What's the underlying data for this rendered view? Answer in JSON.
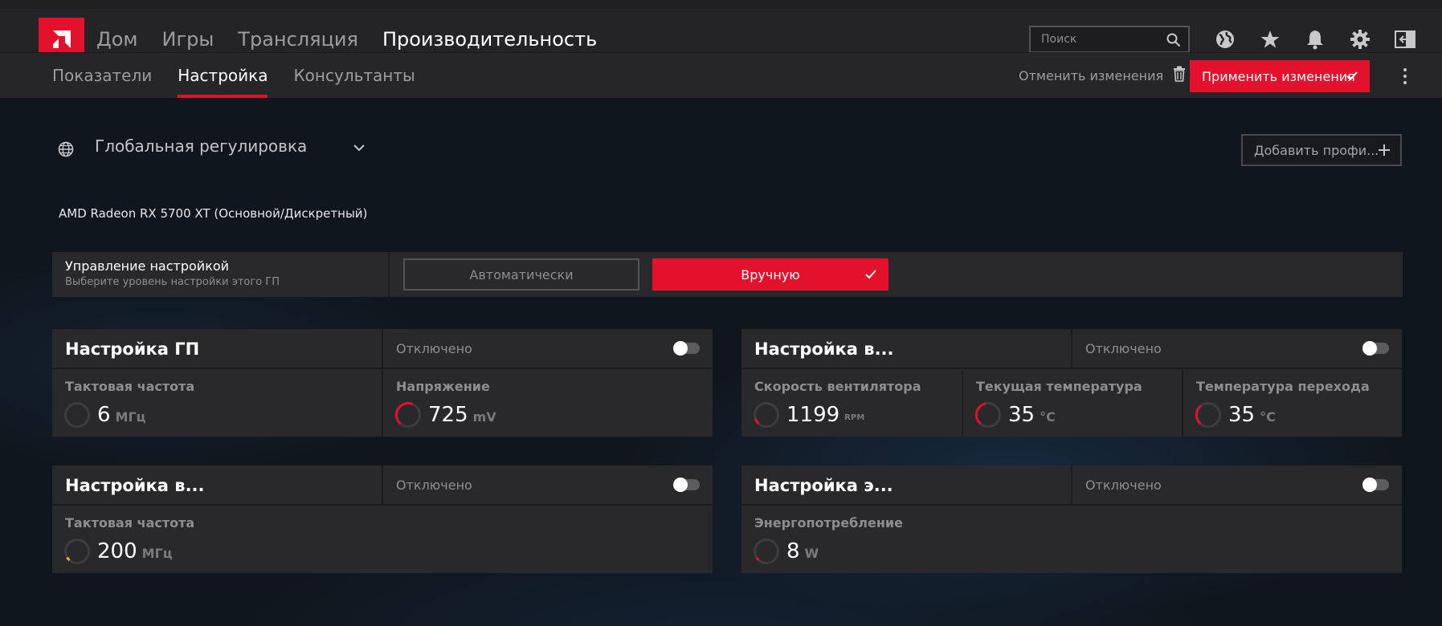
{
  "nav": {
    "main_tabs": [
      "Дом",
      "Игры",
      "Трансляция",
      "Производительность"
    ],
    "active_main": "Производительность",
    "sub_tabs": [
      "Показатели",
      "Настройка",
      "Консультанты"
    ],
    "active_sub": "Настройка"
  },
  "search": {
    "placeholder": "Поиск"
  },
  "header_icons": [
    "globe-icon",
    "star-icon",
    "bell-icon",
    "gear-icon",
    "sidebar-exit-icon"
  ],
  "actions": {
    "discard_label": "Отменить изменения",
    "apply_label": "Применить изменения"
  },
  "profile": {
    "selected": "Глобальная регулировка",
    "add_label": "Добавить профи..."
  },
  "gpu": {
    "name": "AMD Radeon RX 5700 XT (Основной/Дискретный)"
  },
  "tuning_control": {
    "title": "Управление настройкой",
    "subtitle": "Выберите уровень настройки этого ГП",
    "option_auto": "Автоматически",
    "option_manual": "Вручную",
    "selected": "Вручную"
  },
  "panels": {
    "gpu_tuning": {
      "title": "Настройка ГП",
      "state": "Отключено",
      "enabled": false,
      "metrics": [
        {
          "label": "Тактовая частота",
          "value": "6",
          "unit": "МГц"
        },
        {
          "label": "Напряжение",
          "value": "725",
          "unit": "mV"
        }
      ]
    },
    "fan_tuning": {
      "title": "Настройка в...",
      "state": "Отключено",
      "enabled": false,
      "metrics": [
        {
          "label": "Скорость вентилятора",
          "value": "1199",
          "unit": "RPM"
        },
        {
          "label": "Текущая температура",
          "value": "35",
          "unit": "°C"
        },
        {
          "label": "Температура перехода",
          "value": "35",
          "unit": "°C"
        }
      ]
    },
    "vram_tuning": {
      "title": "Настройка в...",
      "state": "Отключено",
      "enabled": false,
      "metrics": [
        {
          "label": "Тактовая частота",
          "value": "200",
          "unit": "МГц"
        }
      ]
    },
    "power_tuning": {
      "title": "Настройка э...",
      "state": "Отключено",
      "enabled": false,
      "metrics": [
        {
          "label": "Энергопотребление",
          "value": "8",
          "unit": "W"
        }
      ]
    }
  },
  "colors": {
    "accent": "#e4112c",
    "gauge_yellow": "#f5b31b",
    "panel_bg": "#29292b",
    "topbar_bg": "#242426"
  }
}
